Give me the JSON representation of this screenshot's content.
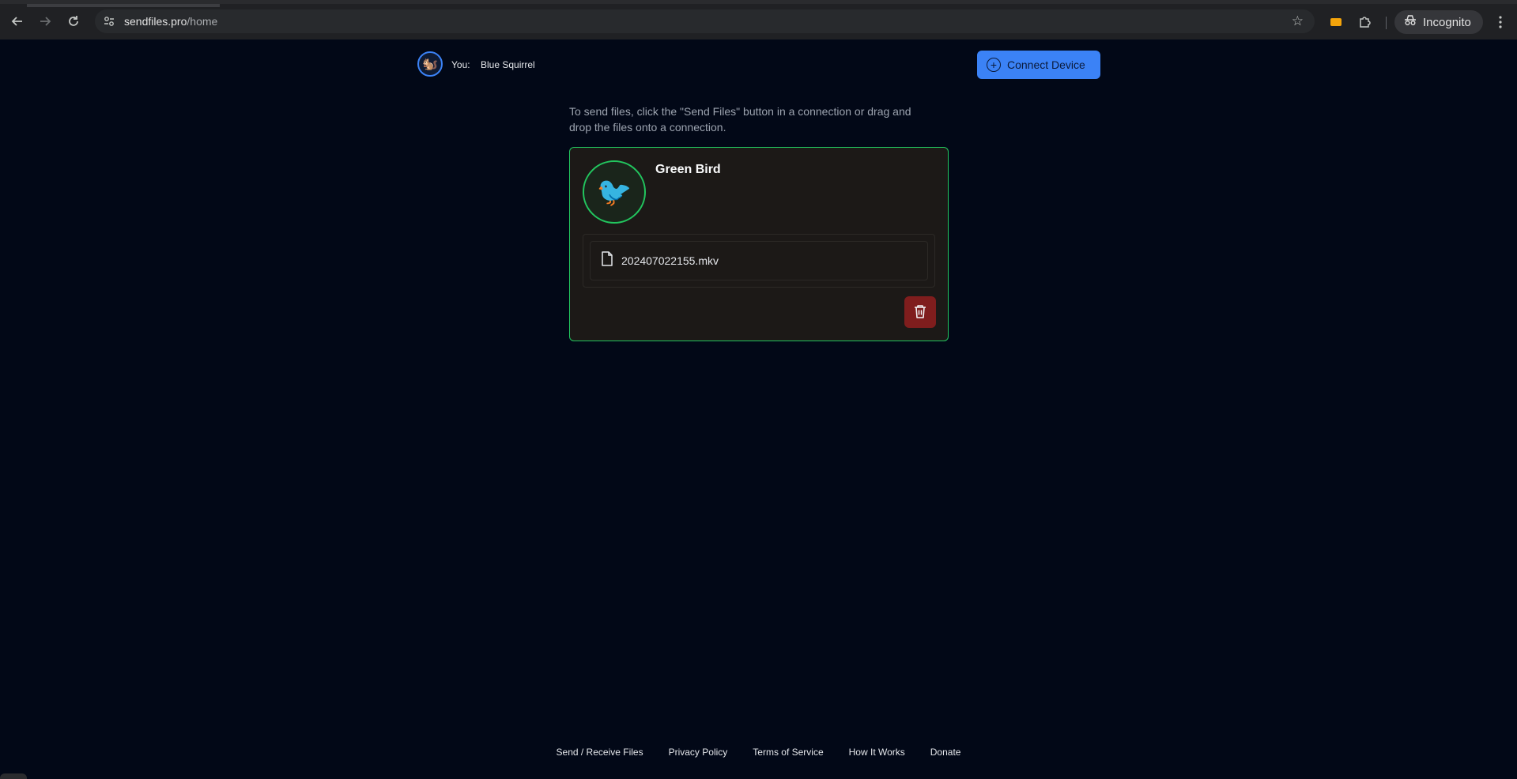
{
  "browser": {
    "url_host": "sendfiles.pro",
    "url_path": "/home",
    "profile_label": "Incognito",
    "icons": [
      "back-icon",
      "forward-icon",
      "reload-icon",
      "site-info-icon",
      "star-icon",
      "extension-icon",
      "puzzle-icon",
      "incognito-icon",
      "menu-icon"
    ]
  },
  "header": {
    "you_label": "You:",
    "user_name": "Blue Squirrel",
    "user_avatar_emoji": "🐿️",
    "connect_button_label": "Connect Device"
  },
  "instructions": "To send files, click the \"Send Files\" button in a connection or drag and drop the files onto a connection.",
  "connection": {
    "peer_name": "Green Bird",
    "peer_avatar_emoji": "🐦",
    "files": [
      {
        "name": "202407022155.mkv"
      }
    ]
  },
  "footer": {
    "links": [
      "Send / Receive Files",
      "Privacy Policy",
      "Terms of Service",
      "How It Works",
      "Donate"
    ]
  },
  "colors": {
    "background": "#020817",
    "accent_blue": "#3b82f6",
    "connection_green": "#22c55e",
    "delete_red": "#7f1d1d",
    "card_bg": "#1c1917"
  }
}
